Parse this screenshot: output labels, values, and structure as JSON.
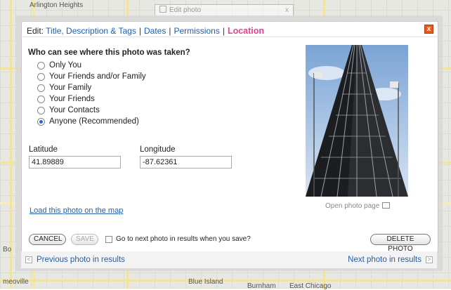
{
  "map": {
    "labels": [
      "Arlington Heights",
      "Blue Island",
      "Burnham",
      "East Chicago",
      "meoville",
      "Bo"
    ]
  },
  "background_tab": {
    "title": "Edit photo",
    "close": "x"
  },
  "header": {
    "prefix": "Edit:",
    "tabs": [
      "Title, Description & Tags",
      "Dates",
      "Permissions",
      "Location"
    ],
    "separator": "|",
    "active_tab": "Location",
    "close_glyph": "x"
  },
  "privacy": {
    "question": "Who can see where this photo was taken?",
    "options": [
      {
        "label": "Only You",
        "checked": false
      },
      {
        "label": "Your Friends and/or Family",
        "checked": false
      },
      {
        "label": "Your Family",
        "checked": false
      },
      {
        "label": "Your Friends",
        "checked": false
      },
      {
        "label": "Your Contacts",
        "checked": false
      },
      {
        "label": "Anyone (Recommended)",
        "checked": true
      }
    ]
  },
  "coords": {
    "latitude_label": "Latitude",
    "latitude_value": "41.89889",
    "longitude_label": "Longitude",
    "longitude_value": "-87.62361"
  },
  "photo": {
    "open_page": "Open photo page"
  },
  "links": {
    "load_on_map": "Load this photo on the map"
  },
  "actions": {
    "cancel": "CANCEL",
    "save": "SAVE",
    "next_checkbox": "Go to next photo in results when you save?",
    "delete": "DELETE PHOTO"
  },
  "footer": {
    "prev": "Previous photo in results",
    "next": "Next photo in results",
    "prev_arrow": "<",
    "next_arrow": ">"
  },
  "colors": {
    "link": "#1f5fae",
    "active_tab": "#e4428e",
    "close": "#e55a1a",
    "radio_checked": "#2a66c7"
  }
}
